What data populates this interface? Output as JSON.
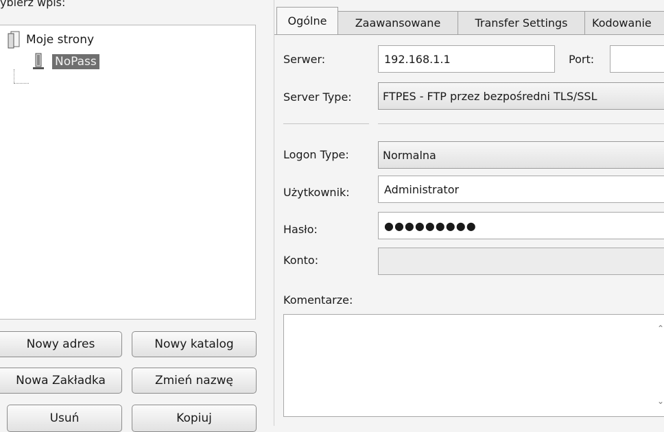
{
  "left_pane": {
    "select_label": "ybierz wpis:",
    "tree": {
      "root_label": "Moje strony",
      "child_label": "NoPass"
    },
    "buttons": {
      "new_site": "Nowy adres",
      "new_folder": "Nowy katalog",
      "new_bookmark": "Nowa Zakładka",
      "rename": "Zmień nazwę",
      "delete": "Usuń",
      "copy": "Kopiuj"
    }
  },
  "tabs": [
    {
      "label": "Ogólne",
      "active": true
    },
    {
      "label": "Zaawansowane",
      "active": false
    },
    {
      "label": "Transfer Settings",
      "active": false
    },
    {
      "label": "Kodowanie",
      "active": false
    }
  ],
  "general": {
    "host_label": "Serwer:",
    "host_value": "192.168.1.1",
    "port_label": "Port:",
    "port_value": "",
    "server_type_label": "Server Type:",
    "server_type_value": "FTPES - FTP przez bezpośredni TLS/SSL",
    "logon_type_label": "Logon Type:",
    "logon_type_value": "Normalna",
    "user_label": "Użytkownik:",
    "user_value": "Administrator",
    "password_label": "Hasło:",
    "password_value": "●●●●●●●●●",
    "account_label": "Konto:",
    "account_value": "",
    "comments_label": "Komentarze:",
    "comments_value": ""
  },
  "icons": {
    "root": "folder-icon",
    "child": "server-icon"
  },
  "colors": {
    "selection": "#6f6f6f"
  }
}
